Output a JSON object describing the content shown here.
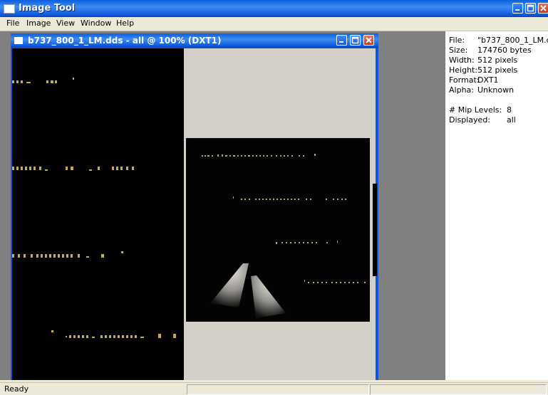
{
  "window": {
    "title": "Image Tool"
  },
  "menu": [
    "File",
    "Image",
    "View",
    "Window",
    "Help"
  ],
  "child_window": {
    "title": "b737_800_1_LM.dds - all @ 100% (DXT1)"
  },
  "info": {
    "file_label": "File:",
    "file_value": "\"b737_800_1_LM.dd",
    "size_label": "Size:",
    "size_value": "174760 bytes",
    "width_label": "Width:",
    "width_value": "512 pixels",
    "height_label": "Height:",
    "height_value": "512 pixels",
    "format_label": "Format:",
    "format_value": "DXT1",
    "alpha_label": "Alpha:",
    "alpha_value": "Unknown",
    "mip_label": "# Mip Levels:",
    "mip_value": "8",
    "displayed_label": "Displayed:",
    "displayed_value": "all"
  },
  "status": {
    "text": "Ready"
  }
}
